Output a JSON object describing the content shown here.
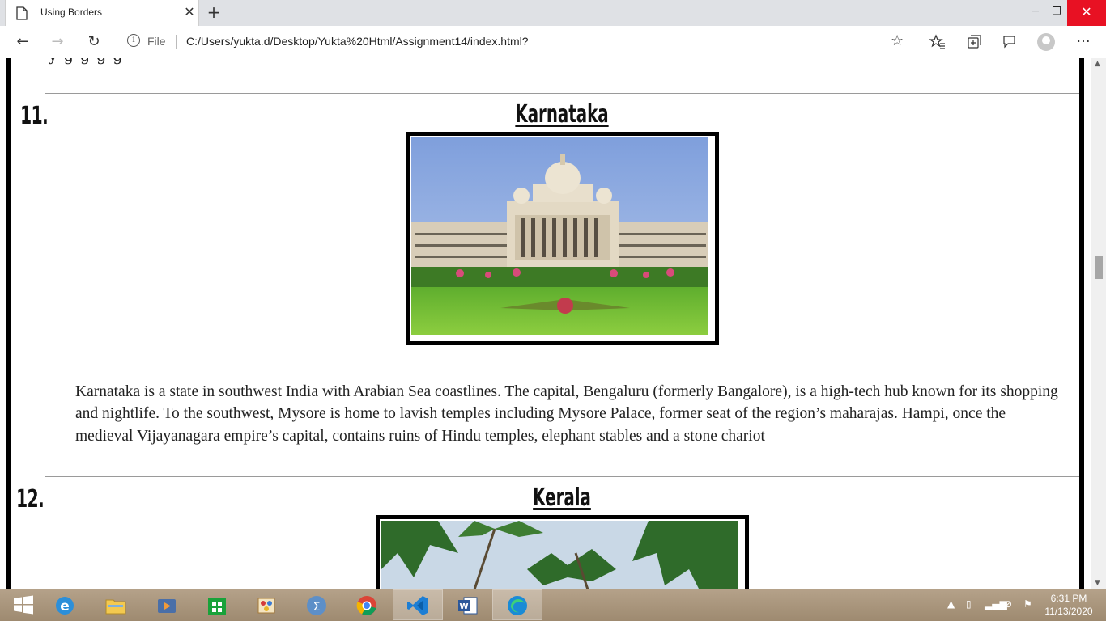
{
  "browser": {
    "tab_title": "Using Borders",
    "address_scheme": "File",
    "address_url": "C:/Users/yukta.d/Desktop/Yukta%20Html/Assignment14/index.html?"
  },
  "page": {
    "partial_top_text": "y                                     g                                                               g                                         g                                             g",
    "sections": [
      {
        "number": "11.",
        "title": "Karnataka",
        "description": "Karnataka is a state in southwest India with Arabian Sea coastlines. The capital, Bengaluru (formerly Bangalore), is a high-tech hub known for its shopping and nightlife. To the southwest, Mysore is home to lavish temples including Mysore Palace, former seat of the region’s maharajas. Hampi, once the medieval Vijayanagara empire’s capital, contains ruins of Hindu temples, elephant stables and a stone chariot"
      },
      {
        "number": "12.",
        "title": "Kerala"
      }
    ]
  },
  "taskbar": {
    "apps": [
      "start",
      "internet-explorer",
      "file-explorer",
      "media-player",
      "store",
      "paint",
      "math-input",
      "chrome",
      "vscode",
      "word",
      "edge"
    ],
    "clock_time": "6:31 PM",
    "clock_date": "11/13/2020"
  }
}
